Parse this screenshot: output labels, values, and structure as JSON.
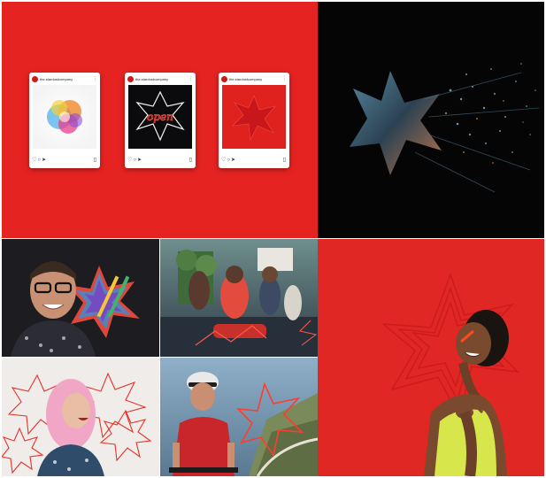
{
  "social_posts": {
    "handle": "the.stardustcompany",
    "cards": [
      {
        "name": "post-color-burst"
      },
      {
        "name": "post-neon-open"
      },
      {
        "name": "post-red-star"
      }
    ],
    "icons": {
      "like": "heart-icon",
      "comment": "comment-icon",
      "share": "send-icon",
      "save": "bookmark-icon",
      "more": "more-icon"
    }
  },
  "colors": {
    "brand_red": "#e52321",
    "black": "#050505",
    "neon_line": "#ff3a2e",
    "white": "#ffffff"
  },
  "neon_text": "open"
}
